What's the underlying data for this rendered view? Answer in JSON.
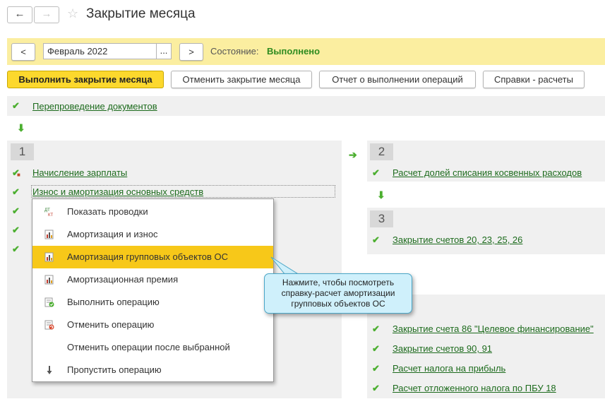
{
  "window": {
    "title": "Закрытие месяца"
  },
  "period": {
    "prev_label": "<",
    "next_label": ">",
    "value": "Февраль 2022",
    "picker_label": "...",
    "state_label": "Состояние:",
    "state_value": "Выполнено"
  },
  "toolbar": {
    "run_label": "Выполнить закрытие месяца",
    "cancel_label": "Отменить закрытие месяца",
    "report_label": "Отчет о выполнении операций",
    "refs_label": "Справки - расчеты"
  },
  "top_step": {
    "label": "Перепроведение документов"
  },
  "group1": {
    "number": "1",
    "items": [
      {
        "label": "Начисление зарплаты"
      },
      {
        "label": "Износ и амортизация основных средств"
      }
    ]
  },
  "group2": {
    "number": "2",
    "items": [
      {
        "label": "Расчет долей списания косвенных расходов"
      }
    ]
  },
  "group3": {
    "number": "3",
    "items": [
      {
        "label": "Закрытие счетов 20, 23, 25, 26"
      }
    ]
  },
  "group4": {
    "items": [
      {
        "label": "Закрытие счета 86 \"Целевое финансирование\""
      },
      {
        "label": "Закрытие счетов 90, 91"
      },
      {
        "label": "Расчет налога на прибыль"
      },
      {
        "label": "Расчет отложенного налога по ПБУ 18"
      }
    ]
  },
  "context_menu": {
    "items": [
      {
        "label": "Показать проводки",
        "icon": "dt-kt-icon"
      },
      {
        "label": "Амортизация и износ",
        "icon": "report-icon"
      },
      {
        "label": "Амортизация групповых объектов ОС",
        "icon": "report-icon",
        "selected": true
      },
      {
        "label": "Амортизационная премия",
        "icon": "report-icon"
      },
      {
        "label": "Выполнить операцию",
        "icon": "run-operation-icon"
      },
      {
        "label": "Отменить операцию",
        "icon": "cancel-operation-icon"
      },
      {
        "label": "Отменить операции после выбранной",
        "icon": ""
      },
      {
        "label": "Пропустить операцию",
        "icon": "skip-arrow-icon"
      }
    ]
  },
  "tooltip": {
    "text": "Нажмите, чтобы посмотреть справку-расчет амортизации групповых объектов ОС"
  },
  "colors": {
    "accent_yellow": "#fcd82d",
    "period_bar": "#fbeea0",
    "link_green": "#1d6b1d",
    "check_green": "#4caf30",
    "tooltip_bg": "#cff0fb"
  }
}
